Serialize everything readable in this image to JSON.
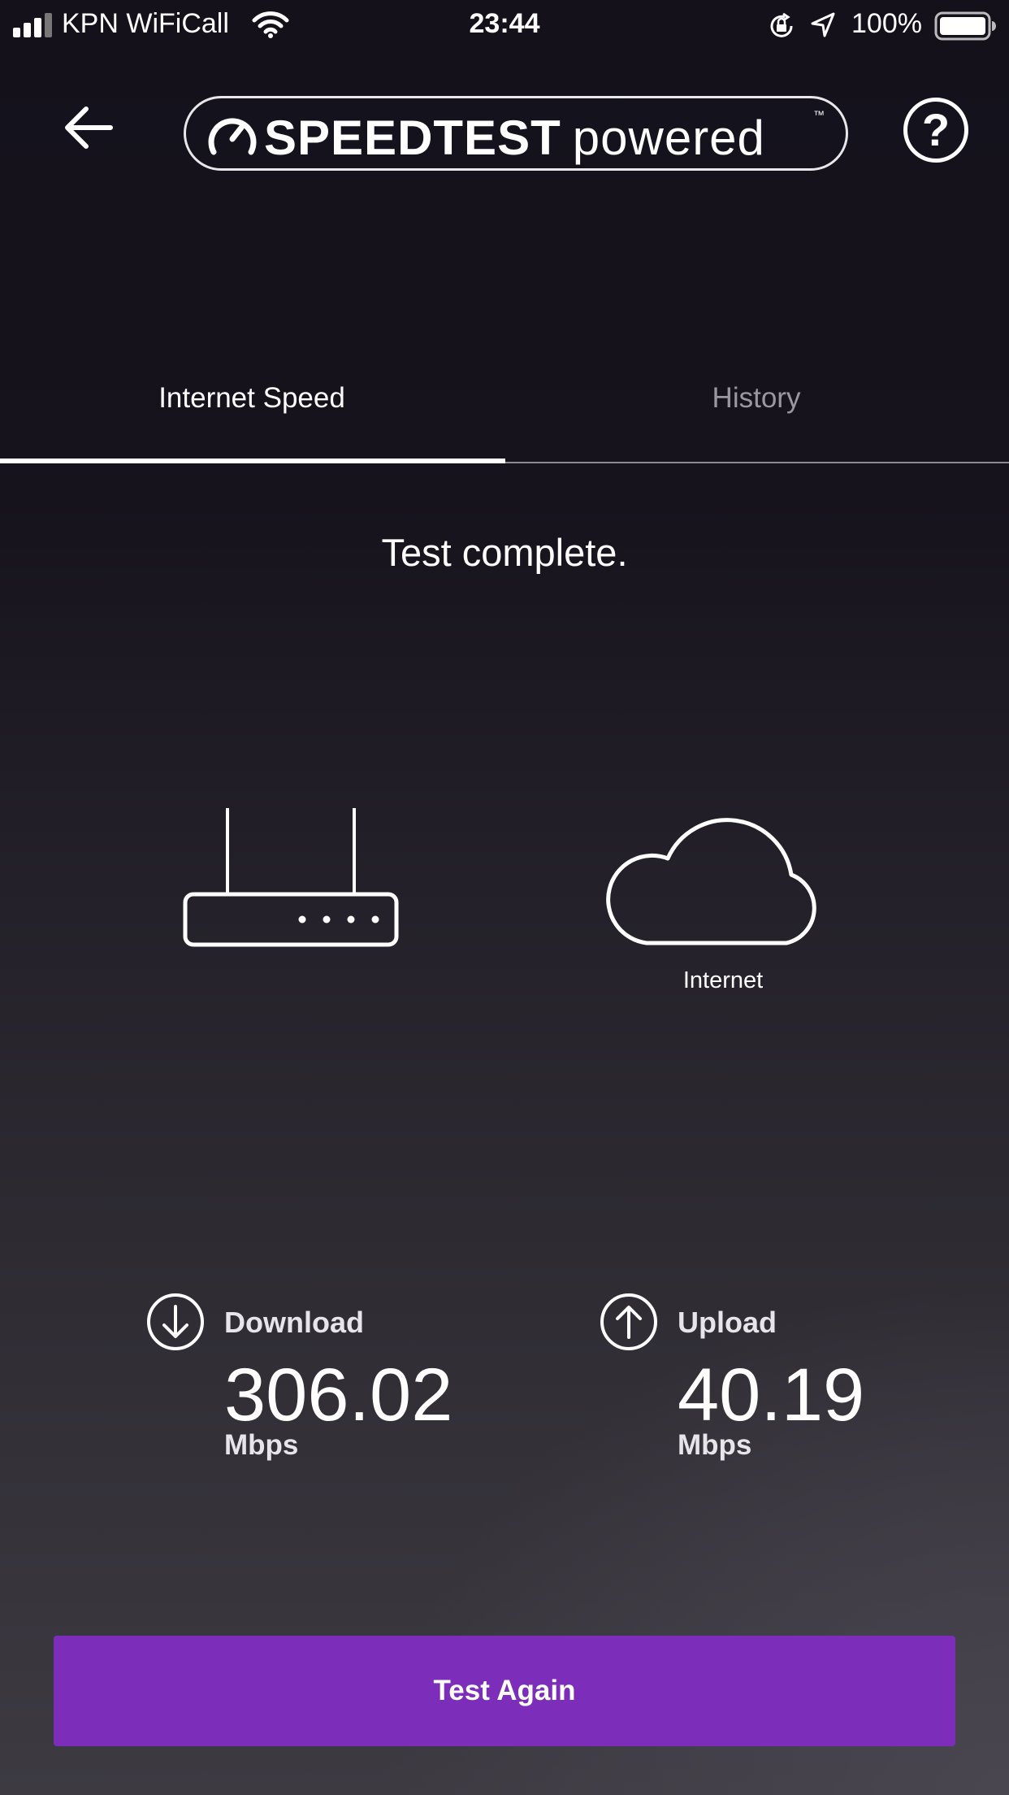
{
  "status_bar": {
    "carrier": "KPN WiFiCall",
    "time": "23:44",
    "battery": "100%"
  },
  "header": {
    "logo_bold": "SPEEDTEST",
    "logo_light": "powered",
    "logo_tm": "™",
    "help_symbol": "?"
  },
  "tabs": [
    {
      "label": "Internet Speed",
      "active": true
    },
    {
      "label": "History",
      "active": false
    }
  ],
  "main": {
    "status": "Test complete.",
    "internet_label": "Internet"
  },
  "download": {
    "label": "Download",
    "value": "306.02",
    "unit": "Mbps"
  },
  "upload": {
    "label": "Upload",
    "value": "40.19",
    "unit": "Mbps"
  },
  "button": {
    "label": "Test Again"
  },
  "colors": {
    "accent": "#7c2ebb",
    "background": "#16131d"
  },
  "icons": [
    "signal-icon",
    "wifi-icon",
    "rotation-lock-icon",
    "location-icon",
    "battery-icon",
    "back-arrow-icon",
    "speedometer-icon",
    "help-icon",
    "router-icon",
    "cloud-icon",
    "download-icon",
    "upload-icon"
  ]
}
